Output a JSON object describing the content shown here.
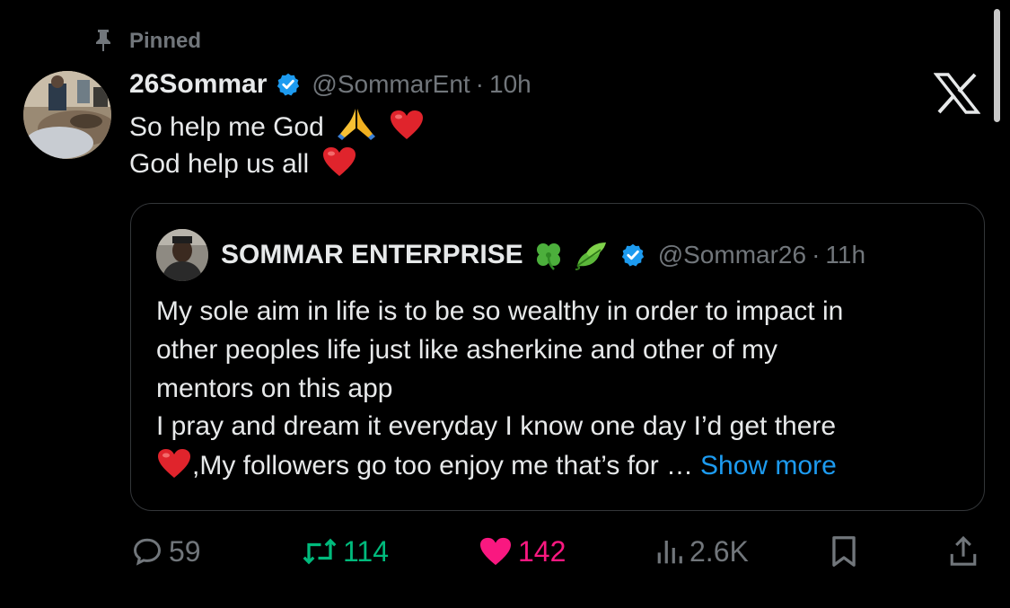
{
  "pinned_label": "Pinned",
  "author": {
    "display_name": "26Sommar",
    "handle": "@SommarEnt",
    "time": "10h"
  },
  "tweet": {
    "line1": "So help me God",
    "line2": "God help us all"
  },
  "quoted": {
    "display_name": "SOMMAR ENTERPRISE",
    "handle": "@Sommar26",
    "time": "11h",
    "lines": [
      "My sole aim in life is to be so wealthy in order to impact in",
      "other peoples life just like asherkine and other of my",
      "mentors on this app",
      "I pray and dream it everyday I know one day I’d get there",
      ",My followers go too enjoy me that’s for …"
    ],
    "show_more": "Show more"
  },
  "actions": {
    "replies": "59",
    "retweets": "114",
    "likes": "142",
    "views": "2.6K"
  },
  "separator": "·",
  "colors": {
    "background": "#000000",
    "text": "#e7e9ea",
    "muted": "#71767b",
    "link": "#1d9bf0",
    "retweet": "#00ba7c",
    "like": "#f91880",
    "border": "#333639"
  },
  "icons": [
    "pin-icon",
    "verified-badge-icon",
    "x-logo-icon",
    "praying-hands-icon",
    "red-heart-icon",
    "four-leaf-clover-icon",
    "leaf-icon",
    "reply-icon",
    "retweet-icon",
    "like-heart-icon",
    "views-icon",
    "bookmark-icon",
    "share-icon"
  ]
}
